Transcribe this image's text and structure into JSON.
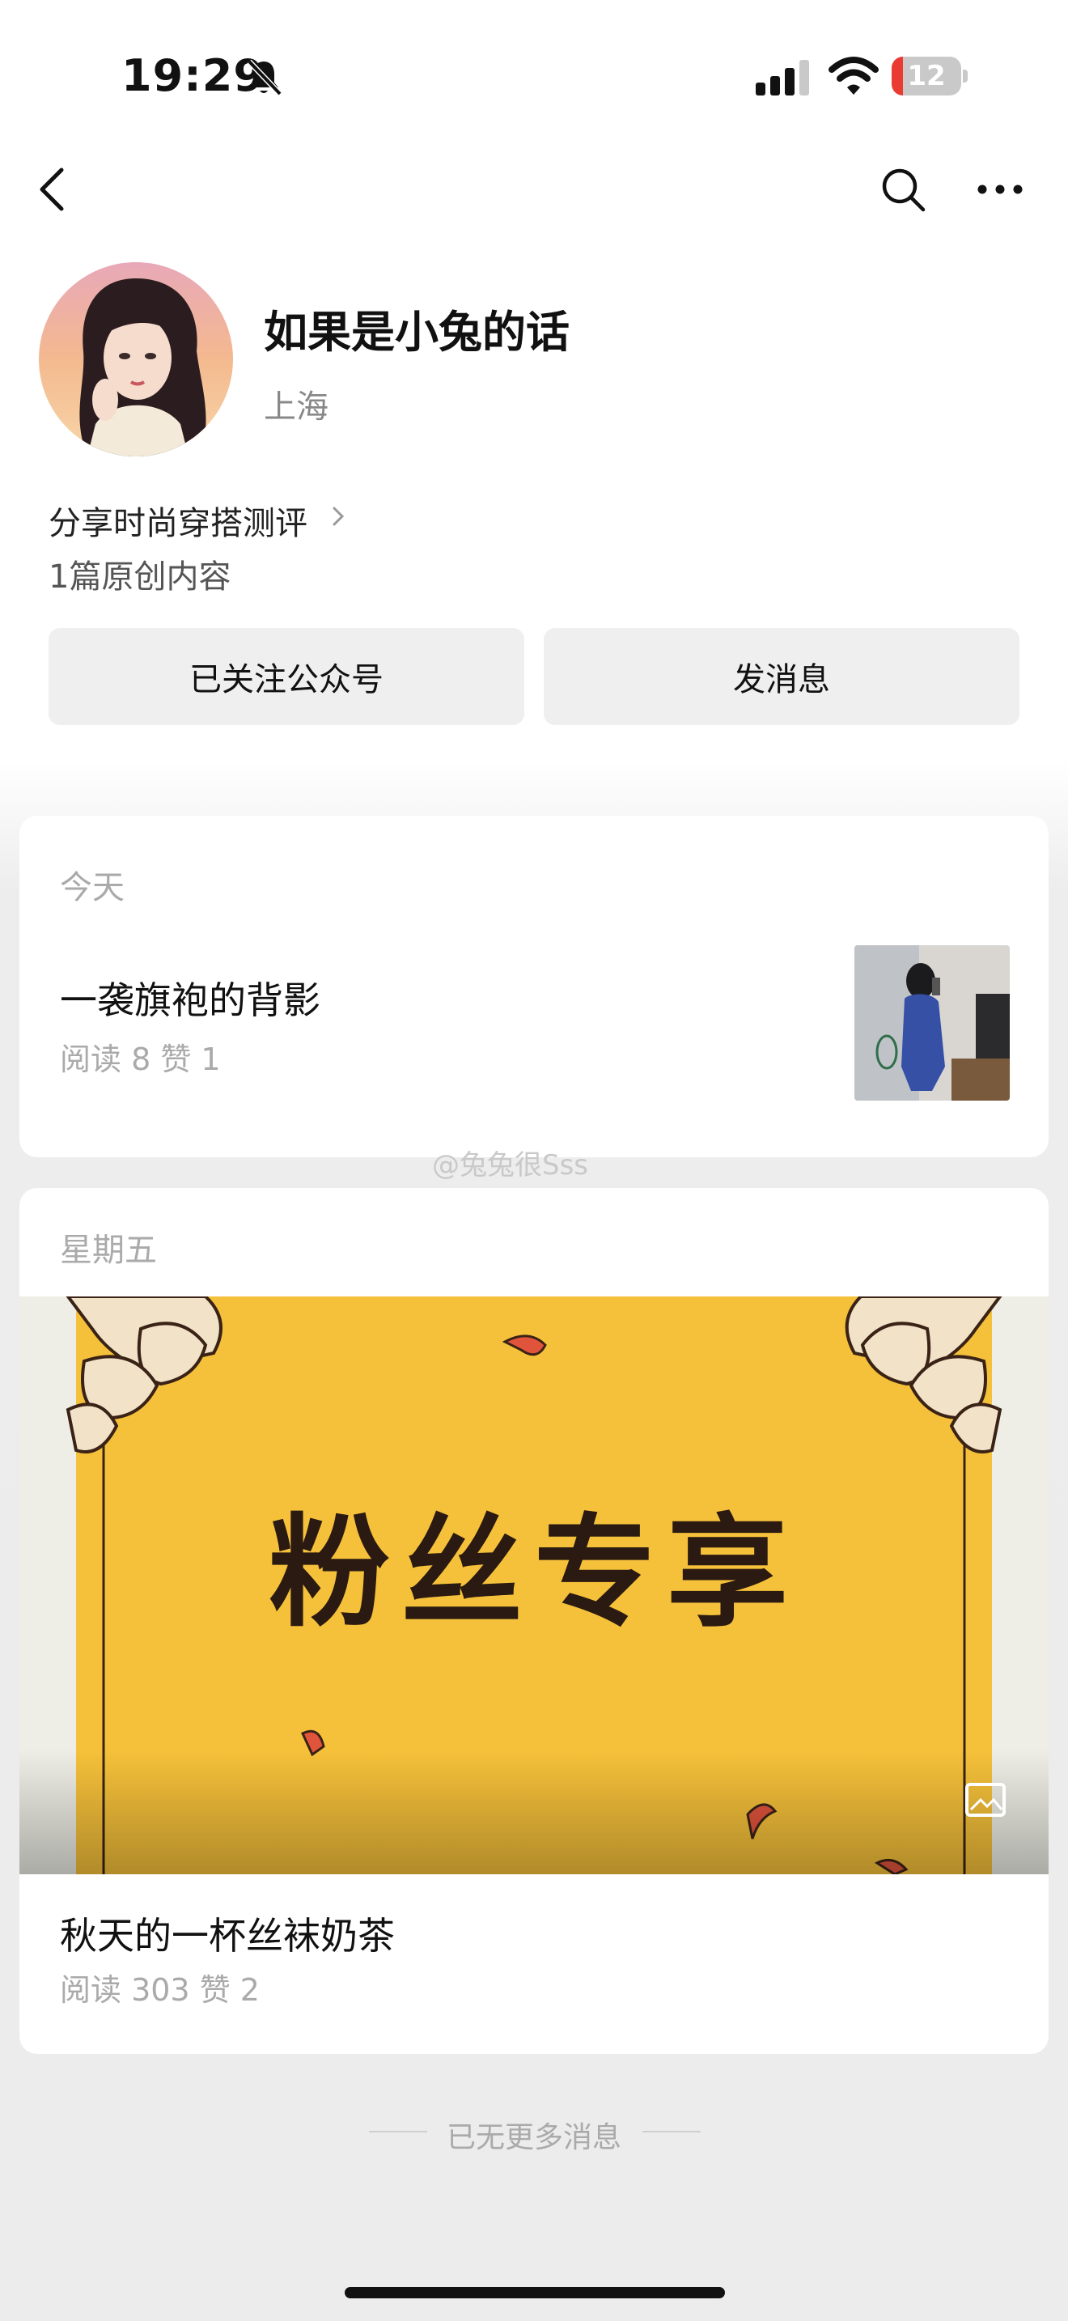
{
  "status_bar": {
    "time": "19:29",
    "battery_level": "12",
    "icons": [
      "bell-slash-icon",
      "signal-icon",
      "wifi-icon",
      "battery-icon"
    ]
  },
  "nav": {
    "icons": [
      "back-icon",
      "search-icon",
      "more-icon"
    ]
  },
  "profile": {
    "name": "如果是小兔的话",
    "location": "上海",
    "description": "分享时尚穿搭测评",
    "original_count": "1篇原创内容"
  },
  "actions": {
    "follow": "已关注公众号",
    "message": "发消息"
  },
  "feed": [
    {
      "date": "今天",
      "title": "一袭旗袍的背影",
      "stats": "阅读 8  赞 1"
    },
    {
      "date": "星期五",
      "cover_text": "粉丝专享",
      "title": "秋天的一杯丝袜奶茶",
      "stats": "阅读 303  赞 2"
    }
  ],
  "footer": {
    "end_text": "已无更多消息"
  },
  "watermark": "@兔兔很Sss",
  "colors": {
    "background": "#ededed",
    "card": "#ffffff",
    "button": "#efefef",
    "cover_yellow": "#f6c13a",
    "battery_low": "#ea3a32"
  }
}
